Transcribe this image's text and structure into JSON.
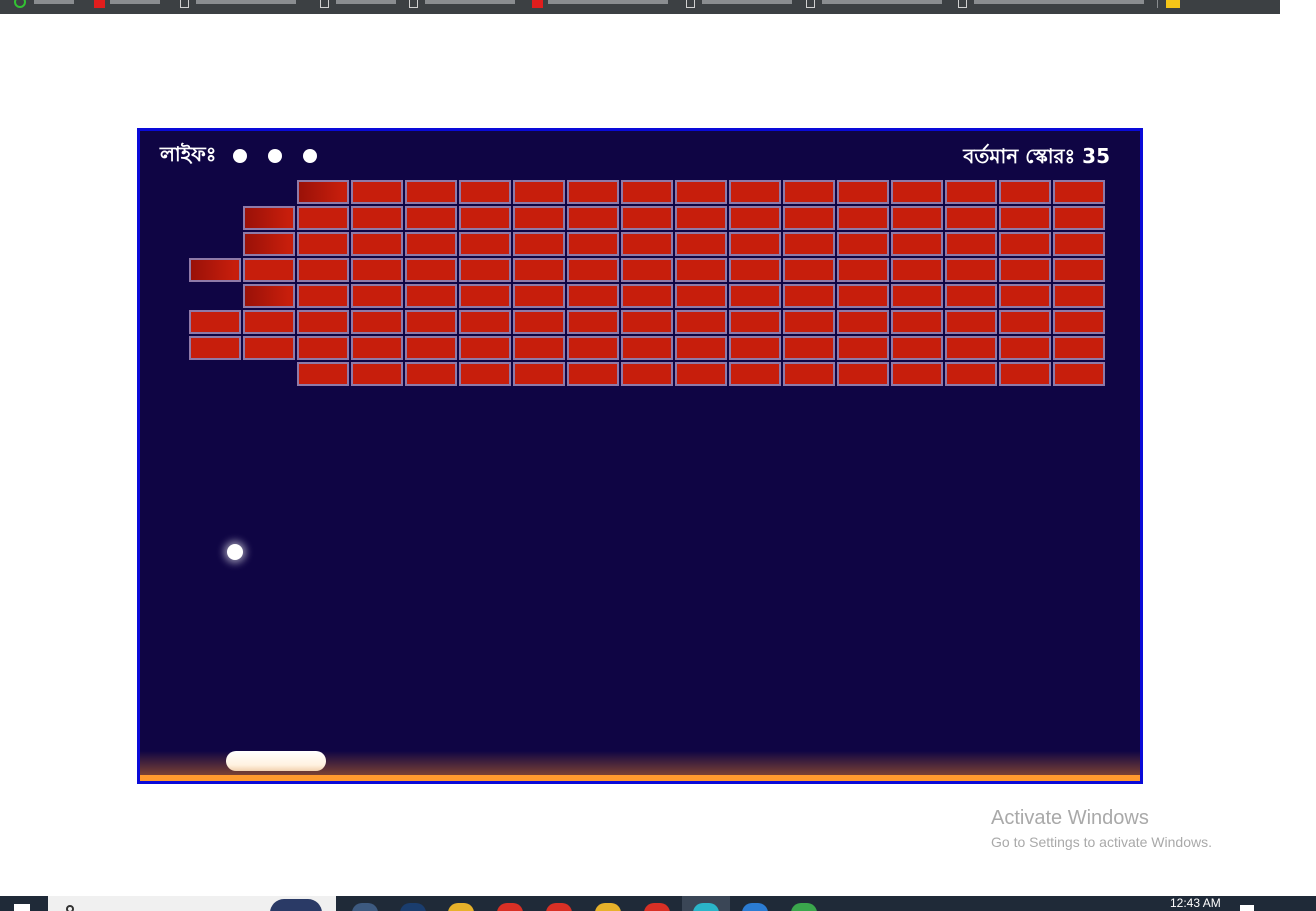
{
  "game": {
    "lives_label": "লাইফঃ",
    "lives_remaining": 3,
    "score_label": "বর্তমান স্কোরঃ",
    "score_value": "35",
    "score_text": "বর্তমান স্কোরঃ 35",
    "brick_rows": [
      [
        0,
        0,
        1,
        1,
        1,
        1,
        1,
        1,
        1,
        1,
        1,
        1,
        1,
        1,
        1,
        1,
        1
      ],
      [
        0,
        1,
        1,
        1,
        1,
        1,
        1,
        1,
        1,
        1,
        1,
        1,
        1,
        1,
        1,
        1,
        1
      ],
      [
        0,
        1,
        1,
        1,
        1,
        1,
        1,
        1,
        1,
        1,
        1,
        1,
        1,
        1,
        1,
        1,
        1
      ],
      [
        1,
        1,
        1,
        1,
        1,
        1,
        1,
        1,
        1,
        1,
        1,
        1,
        1,
        1,
        1,
        1,
        1
      ],
      [
        0,
        1,
        1,
        1,
        1,
        1,
        1,
        1,
        1,
        1,
        1,
        1,
        1,
        1,
        1,
        1,
        1
      ],
      [
        1,
        1,
        1,
        1,
        1,
        1,
        1,
        1,
        1,
        1,
        1,
        1,
        1,
        1,
        1,
        1,
        1
      ],
      [
        1,
        1,
        1,
        1,
        1,
        1,
        1,
        1,
        1,
        1,
        1,
        1,
        1,
        1,
        1,
        1,
        1
      ],
      [
        0,
        0,
        1,
        1,
        1,
        1,
        1,
        1,
        1,
        1,
        1,
        1,
        1,
        1,
        1,
        1,
        1
      ]
    ],
    "colors": {
      "background": "#0f0544",
      "border": "#0a0ad8",
      "brick": "#c71e0c",
      "brick_border": "#8f7aa8",
      "ground": "#ff9a2e",
      "ball": "#ffffff",
      "paddle": "#fff2e0"
    }
  },
  "watermark": {
    "title": "Activate Windows",
    "subtitle": "Go to Settings to activate Windows."
  },
  "taskbar": {
    "clock": "12:43 AM"
  }
}
